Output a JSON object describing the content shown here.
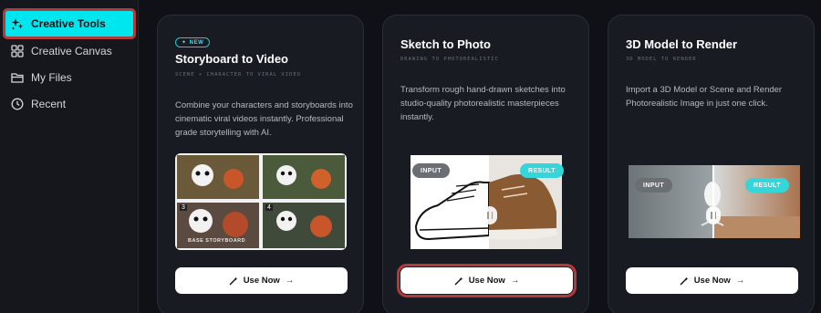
{
  "sidebar": {
    "items": [
      {
        "label": "Creative Tools",
        "icon": "sparkle-icon",
        "active": true
      },
      {
        "label": "Creative Canvas",
        "icon": "grid-icon",
        "active": false
      },
      {
        "label": "My Files",
        "icon": "folder-icon",
        "active": false
      },
      {
        "label": "Recent",
        "icon": "clock-icon",
        "active": false
      }
    ]
  },
  "cards": [
    {
      "badge": "NEW",
      "title": "Storyboard to Video",
      "subtitle": "SCENE + CHARACTER TO VIRAL VIDEO",
      "description": "Combine your characters and storyboards into cinematic viral videos instantly. Professional grade storytelling with AI.",
      "image_label": "BASE STORYBOARD",
      "panel_numbers": [
        "3",
        "4"
      ],
      "button": "Use Now"
    },
    {
      "title": "Sketch to Photo",
      "subtitle": "DRAWING TO PHOTOREALISTIC",
      "description": "Transform rough hand-drawn sketches into studio-quality photorealistic masterpieces instantly.",
      "input_label": "INPUT",
      "result_label": "RESULT",
      "button": "Use Now"
    },
    {
      "title": "3D Model to Render",
      "subtitle": "3D MODEL TO RENDER",
      "description": "Import a 3D Model or Scene and Render Photorealistic Image in just one click.",
      "input_label": "INPUT",
      "result_label": "RESULT",
      "button": "Use Now"
    }
  ],
  "colors": {
    "accent": "#00e6ef",
    "highlight_border": "#b33a3a",
    "background": "#0f1117",
    "card": "#191b22"
  }
}
